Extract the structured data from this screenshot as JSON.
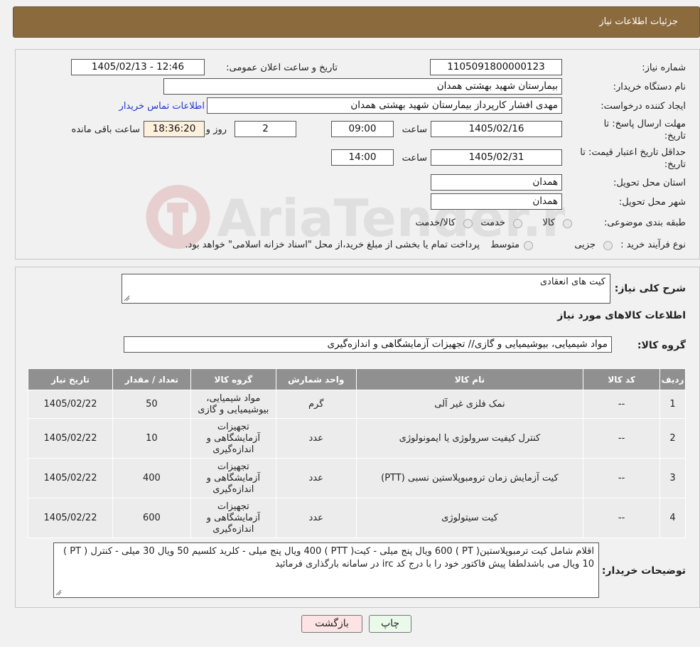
{
  "header": {
    "title": "جزئیات اطلاعات نیاز"
  },
  "fields": {
    "need_number_label": "شماره نیاز:",
    "need_number": "1105091800000123",
    "announce_label": "تاریخ و ساعت اعلان عمومی:",
    "announce_value": "1405/02/13 - 12:46",
    "buyer_org_label": "نام دستگاه خریدار:",
    "buyer_org": "بیمارستان شهید بهشتی همدان",
    "creator_label": "ایجاد کننده درخواست:",
    "creator": "مهدی افشار کارپرداز بیمارستان شهید بهشتی همدان",
    "contact_link": "اطلاعات تماس خریدار",
    "deadline_label_1": "مهلت ارسال پاسخ: تا",
    "deadline_label_2": "تاریخ:",
    "deadline_date": "1405/02/16",
    "hour_label": "ساعت",
    "deadline_time": "09:00",
    "days_value": "2",
    "days_label": "روز و",
    "remaining_time": "18:36:20",
    "remaining_label": "ساعت باقی مانده",
    "validity_label_1": "حداقل تاریخ اعتبار قیمت: تا",
    "validity_label_2": "تاریخ:",
    "validity_date": "1405/02/31",
    "validity_hour_label": "ساعت",
    "validity_time": "14:00",
    "province_label": "استان محل تحویل:",
    "province": "همدان",
    "city_label": "شهر محل تحویل:",
    "city": "همدان",
    "category_label": "طبقه بندی موضوعی:",
    "category_options": [
      "کالا",
      "خدمت",
      "کالا/خدمت"
    ],
    "process_label": "نوع فرآیند خرید :",
    "process_options": [
      "جزیی",
      "متوسط"
    ],
    "process_note": "پرداخت تمام یا بخشی از مبلغ خرید،از محل \"اسناد خزانه اسلامی\" خواهد بود."
  },
  "summary": {
    "label": "شرح کلی نیاز:",
    "value": "کیت های انعقادی",
    "goods_info_title": "اطلاعات کالاهای مورد نیاز",
    "group_label": "گروه کالا:",
    "group_value": "مواد شیمیایی، بیوشیمیایی و گازی// تجهیزات آزمایشگاهی و اندازه‌گیری"
  },
  "table": {
    "headers": [
      "ردیف",
      "کد کالا",
      "نام کالا",
      "واحد شمارش",
      "گروه کالا",
      "تعداد / مقدار",
      "تاریخ نیاز"
    ],
    "rows": [
      [
        "1",
        "--",
        "نمک فلزی غیر آلی",
        "گرم",
        "مواد شیمیایی، بیوشیمیایی و گازی",
        "50",
        "1405/02/22"
      ],
      [
        "2",
        "--",
        "کنترل کیفیت سرولوژی یا ایمونولوژی",
        "عدد",
        "تجهیزات آزمایشگاهی و اندازه‌گیری",
        "10",
        "1405/02/22"
      ],
      [
        "3",
        "--",
        "کیت آزمایش زمان ترومبوپلاستین نسبی (PTT)",
        "عدد",
        "تجهیزات آزمایشگاهی و اندازه‌گیری",
        "400",
        "1405/02/22"
      ],
      [
        "4",
        "--",
        "کیت سیتولوژی",
        "عدد",
        "تجهیزات آزمایشگاهی و اندازه‌گیری",
        "600",
        "1405/02/22"
      ]
    ]
  },
  "buyer_notes": {
    "label": "توضیحات خریدار:",
    "value": "اقلام شامل کیت ترمبوپلاستین( PT ) 600 ویال پنج میلی - کیت( PTT ) 400 ویال پنج میلی - کلرید کلسیم 50 ویال 30 میلی - کنترل ( PT ) 10 ویال می باشدلطفا پیش فاکتور خود را با درج کد irc در سامانه بارگذاری فرمائید"
  },
  "buttons": {
    "print": "چاپ",
    "back": "بازگشت"
  },
  "colors": {
    "header": "#8b6a3e",
    "table_header": "#909090",
    "link": "#2236d6"
  }
}
